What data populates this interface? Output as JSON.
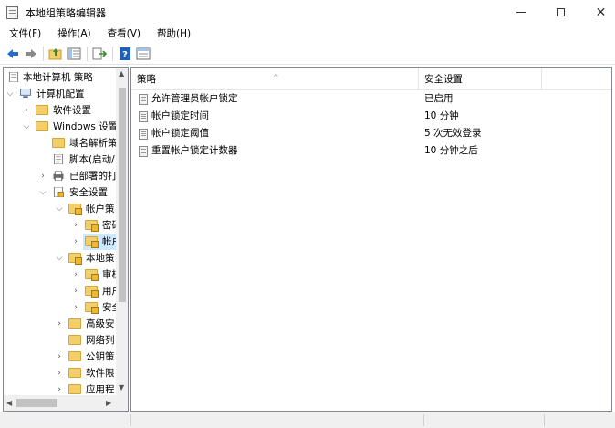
{
  "window": {
    "title": "本地组策略编辑器"
  },
  "menu": [
    {
      "label": "文件(F)"
    },
    {
      "label": "操作(A)"
    },
    {
      "label": "查看(V)"
    },
    {
      "label": "帮助(H)"
    }
  ],
  "toolbar": {
    "icons": [
      "back-arrow-icon",
      "forward-arrow-icon",
      "up-folder-icon",
      "show-hide-tree-icon",
      "export-list-icon",
      "help-icon",
      "properties-icon"
    ]
  },
  "tree": {
    "items": [
      {
        "label": "本地计算机 策略"
      },
      {
        "label": "计算机配置"
      },
      {
        "label": "软件设置"
      },
      {
        "label": "Windows 设置"
      },
      {
        "label": "域名解析策"
      },
      {
        "label": "脚本(启动/"
      },
      {
        "label": "已部署的打"
      },
      {
        "label": "安全设置"
      },
      {
        "label": "帐户策"
      },
      {
        "label": "密码"
      },
      {
        "label": "帐户"
      },
      {
        "label": "本地策"
      },
      {
        "label": "审核"
      },
      {
        "label": "用户"
      },
      {
        "label": "安全"
      },
      {
        "label": "高级安"
      },
      {
        "label": "网络列"
      },
      {
        "label": "公钥策"
      },
      {
        "label": "软件限"
      },
      {
        "label": "应用程"
      }
    ]
  },
  "list": {
    "columns": {
      "policy": "策略",
      "setting": "安全设置"
    },
    "rows": [
      {
        "policy": "允许管理员帐户锁定",
        "setting": "已启用"
      },
      {
        "policy": "帐户锁定时间",
        "setting": "10 分钟"
      },
      {
        "policy": "帐户锁定阈值",
        "setting": "5 次无效登录"
      },
      {
        "policy": "重置帐户锁定计数器",
        "setting": "10 分钟之后"
      }
    ]
  },
  "colors": {
    "selection": "#cde8ff",
    "back_arrow": "#1f6fd1",
    "folder": "#f3cf6b"
  }
}
